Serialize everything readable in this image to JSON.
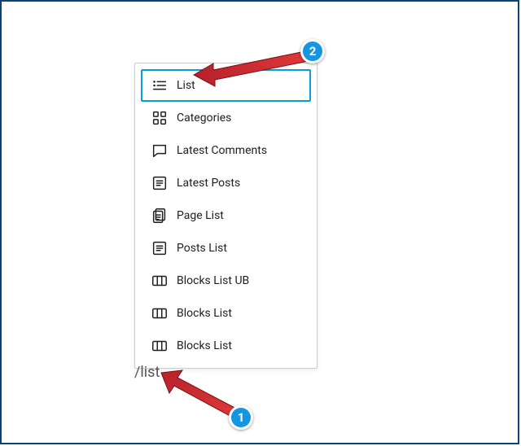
{
  "slash_command": "/list",
  "menu": {
    "items": [
      {
        "label": "List",
        "icon": "list",
        "selected": true
      },
      {
        "label": "Categories",
        "icon": "grid"
      },
      {
        "label": "Latest Comments",
        "icon": "comment"
      },
      {
        "label": "Latest Posts",
        "icon": "lines-box"
      },
      {
        "label": "Page List",
        "icon": "pages"
      },
      {
        "label": "Posts List",
        "icon": "lines-box"
      },
      {
        "label": "Blocks List UB",
        "icon": "columns"
      },
      {
        "label": "Blocks List",
        "icon": "columns"
      },
      {
        "label": "Blocks List",
        "icon": "columns"
      }
    ]
  },
  "annotations": {
    "badge1": "1",
    "badge2": "2"
  }
}
